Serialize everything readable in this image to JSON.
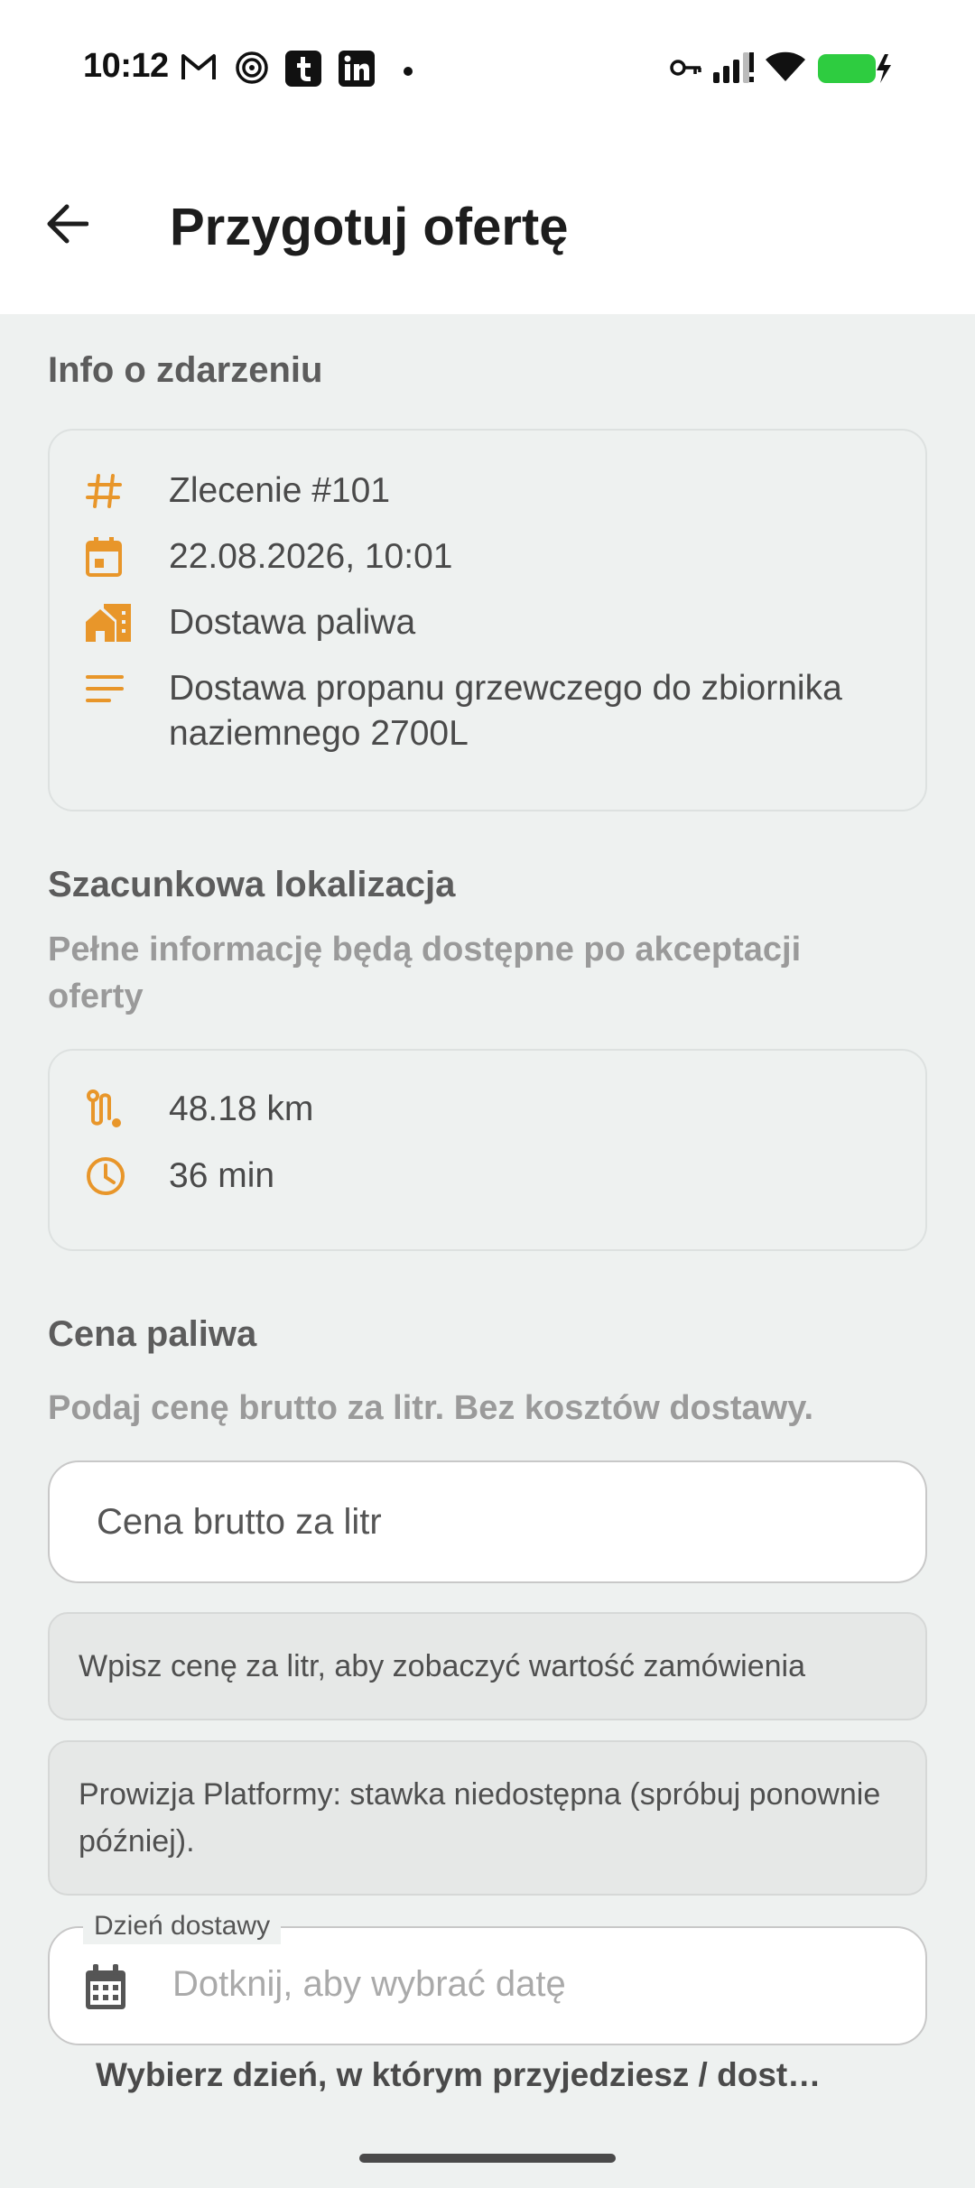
{
  "status_bar": {
    "time": "10:12",
    "left_icons": [
      "gmail-icon",
      "target-icon",
      "tumblr-icon",
      "linkedin-icon",
      "dot-icon"
    ],
    "right_icons": [
      "vpn-key-icon",
      "signal-icon",
      "wifi-icon",
      "battery-charging-icon"
    ],
    "battery_color": "#2ecc40"
  },
  "header": {
    "title": "Przygotuj ofertę"
  },
  "event_info": {
    "title": "Info o zdarzeniu",
    "order_number": "Zlecenie #101",
    "datetime": "22.08.2026, 10:01",
    "category": "Dostawa paliwa",
    "description": "Dostawa propanu grzewczego do zbiornika naziemnego 2700L"
  },
  "location": {
    "title": "Szacunkowa lokalizacja",
    "subtitle": "Pełne informację będą dostępne po akceptacji oferty",
    "distance": "48.18 km",
    "duration": "36 min"
  },
  "fuel_price": {
    "title": "Cena paliwa",
    "subtitle": "Podaj cenę brutto za litr. Bez kosztów dostawy.",
    "input_value": "",
    "input_placeholder": "Cena brutto za litr",
    "order_value_hint": "Wpisz cenę za litr, aby zobaczyć wartość zamówienia",
    "commission_info": "Prowizja Platformy: stawka niedostępna (spróbuj ponownie później)."
  },
  "delivery_day": {
    "label": "Dzień dostawy",
    "placeholder": "Dotknij, aby wybrać datę",
    "helper": "Wybierz dzień, w którym przyjedziesz / dost…"
  },
  "colors": {
    "accent": "#e8962a",
    "background": "#eef1f0",
    "surface": "#ffffff"
  }
}
